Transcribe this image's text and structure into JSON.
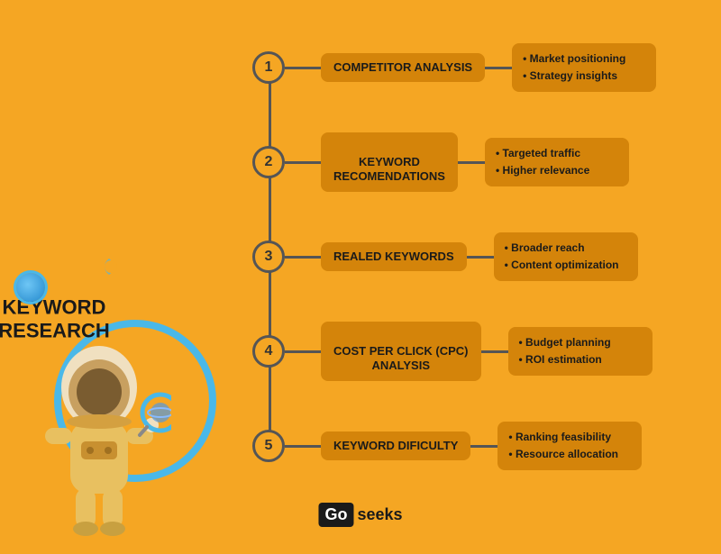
{
  "background_color": "#F5A623",
  "title": "KEYWORD RESEARCH",
  "steps": [
    {
      "number": "1",
      "label": "COMPETITOR ANALYSIS",
      "details": [
        "Market positioning",
        "Strategy insights"
      ]
    },
    {
      "number": "2",
      "label": "KEYWORD\nRECOMENDATIONS",
      "details": [
        "Targeted traffic",
        "Higher relevance"
      ]
    },
    {
      "number": "3",
      "label": "REALED KEYWORDS",
      "details": [
        "Broader reach",
        "Content optimization"
      ]
    },
    {
      "number": "4",
      "label": "COST PER CLICK (CPC)\nANALYSIS",
      "details": [
        "Budget planning",
        "ROI estimation"
      ]
    },
    {
      "number": "5",
      "label": "KEYWORD DIFICULTY",
      "details": [
        "Ranking feasibility",
        "Resource allocation"
      ]
    }
  ],
  "logo": {
    "go": "Go",
    "seeks": "seeks"
  }
}
